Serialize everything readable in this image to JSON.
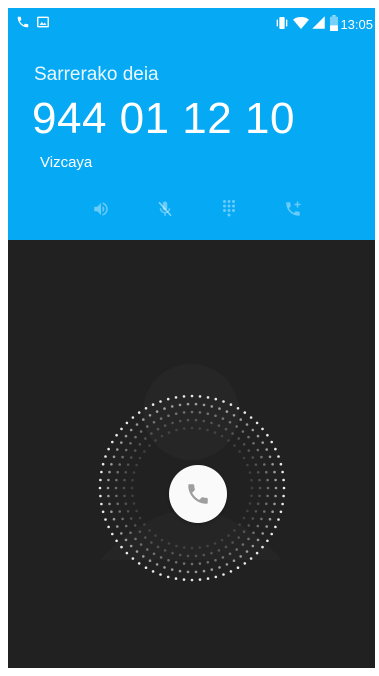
{
  "status_bar": {
    "time": "13:05",
    "left_icons": [
      "phone-call-icon",
      "gallery-icon"
    ],
    "right_icons": [
      "vibrate-icon",
      "wifi-icon",
      "signal-icon",
      "battery-icon"
    ]
  },
  "call": {
    "label": "Sarrerako deia",
    "number": "944 01 12 10",
    "location": "Vizcaya"
  },
  "controls": [
    {
      "name": "speaker-icon",
      "enabled": false
    },
    {
      "name": "mute-icon",
      "enabled": false
    },
    {
      "name": "dialpad-icon",
      "enabled": false
    },
    {
      "name": "add-call-icon",
      "enabled": false
    }
  ],
  "colors": {
    "header": "#06a9f4",
    "background": "#212121",
    "answer_icon": "#9e9e9e"
  }
}
